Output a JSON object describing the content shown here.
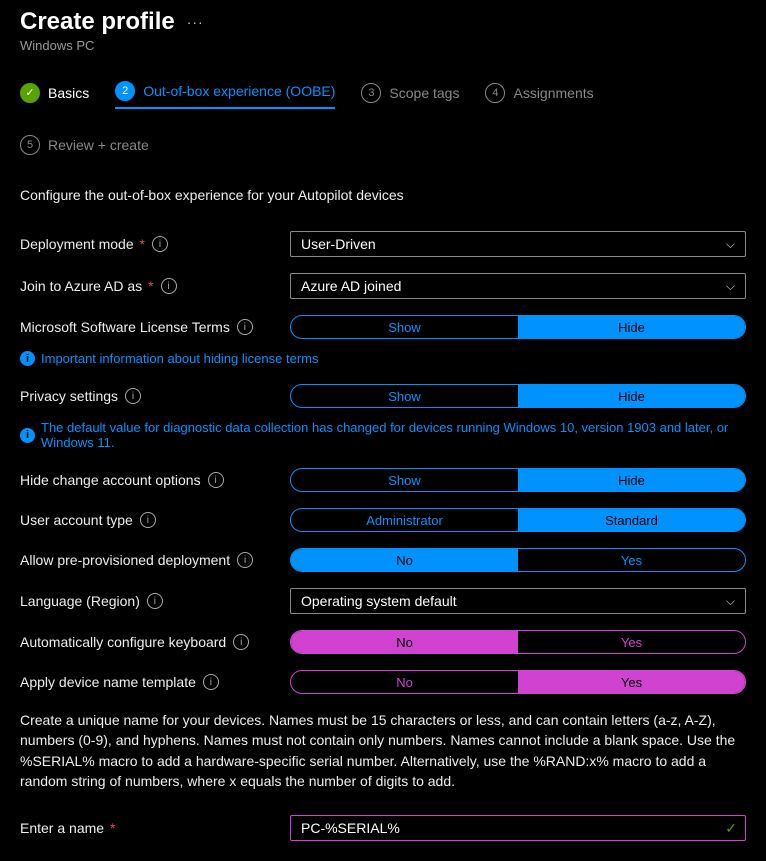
{
  "header": {
    "title": "Create profile",
    "subtitle": "Windows PC",
    "more": "···"
  },
  "tabs": {
    "t1": {
      "num": "✓",
      "label": "Basics"
    },
    "t2": {
      "num": "2",
      "label": "Out-of-box experience (OOBE)"
    },
    "t3": {
      "num": "3",
      "label": "Scope tags"
    },
    "t4": {
      "num": "4",
      "label": "Assignments"
    },
    "t5": {
      "num": "5",
      "label": "Review + create"
    }
  },
  "intro": "Configure the out-of-box experience for your Autopilot devices",
  "labels": {
    "deployment_mode": "Deployment mode",
    "join_aad": "Join to Azure AD as",
    "license_terms": "Microsoft Software License Terms",
    "privacy": "Privacy settings",
    "hide_change": "Hide change account options",
    "user_account": "User account type",
    "allow_pre": "Allow pre-provisioned deployment",
    "language": "Language (Region)",
    "auto_kb": "Automatically configure keyboard",
    "apply_tmpl": "Apply device name template",
    "enter_name": "Enter a name"
  },
  "values": {
    "deployment_mode": "User-Driven",
    "join_aad": "Azure AD joined",
    "language": "Operating system default",
    "name_input": "PC-%SERIAL%"
  },
  "options": {
    "show": "Show",
    "hide": "Hide",
    "administrator": "Administrator",
    "standard": "Standard",
    "no": "No",
    "yes": "Yes"
  },
  "notes": {
    "license": "Important information about hiding license terms",
    "privacy": "The default value for diagnostic data collection has changed for devices running Windows 10, version 1903 and later, or Windows 11."
  },
  "desc": "Create a unique name for your devices. Names must be 15 characters or less, and can contain letters (a-z, A-Z), numbers (0-9), and hyphens. Names must not contain only numbers. Names cannot include a blank space. Use the %SERIAL% macro to add a hardware-specific serial number. Alternatively, use the %RAND:x% macro to add a random string of numbers, where x equals the number of digits to add.",
  "glyphs": {
    "i": "i",
    "chev": "⌵",
    "check": "✓"
  }
}
